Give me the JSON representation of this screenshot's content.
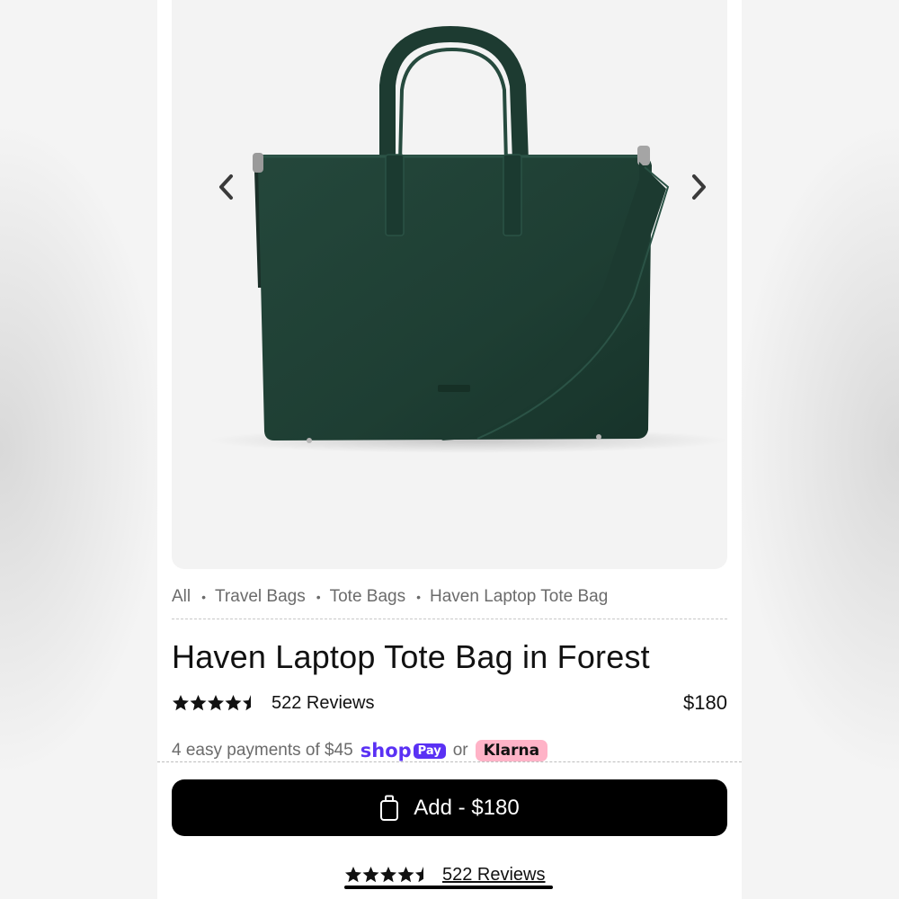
{
  "gallery": {
    "product_image": "haven-laptop-tote-forest",
    "prev_icon": "chevron-left-icon",
    "next_icon": "chevron-right-icon"
  },
  "breadcrumb": {
    "items": [
      {
        "label": "All"
      },
      {
        "label": "Travel Bags"
      },
      {
        "label": "Tote Bags"
      },
      {
        "label": "Haven Laptop Tote Bag"
      }
    ]
  },
  "product": {
    "title": "Haven Laptop Tote Bag in Forest",
    "rating": 4.5,
    "rating_max": 5,
    "reviews_label": "522 Reviews",
    "price": "$180"
  },
  "installments": {
    "text": "4 easy payments of $45",
    "shop_label": "shop",
    "pay_label": "Pay",
    "or_label": "or",
    "klarna_label": "Klarna"
  },
  "cta": {
    "add_label": "Add - $180",
    "icon": "shopping-bag-icon"
  },
  "sticky": {
    "reviews_label": "522 Reviews"
  },
  "colors": {
    "bag": "#1f3d33",
    "shop_pay": "#5a31f4",
    "klarna": "#ffb3c7",
    "button": "#000000"
  }
}
